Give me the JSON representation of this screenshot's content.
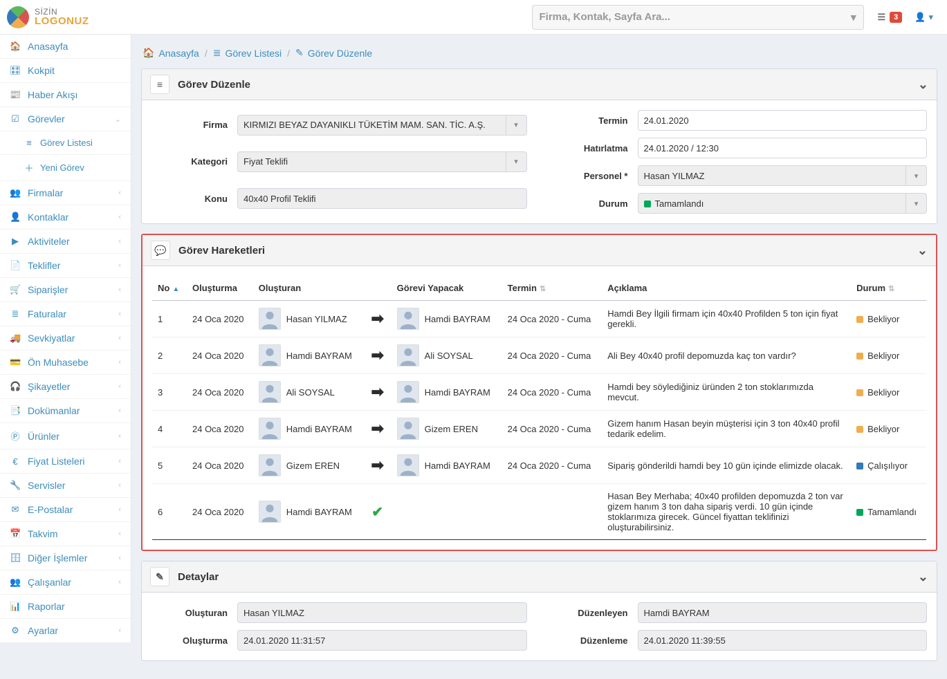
{
  "header": {
    "logo_top": "SİZİN",
    "logo_bottom": "LOGONUZ",
    "search_placeholder": "Firma, Kontak, Sayfa Ara...",
    "notif_count": "3"
  },
  "sidebar": {
    "home": "Anasayfa",
    "cockpit": "Kokpit",
    "news": "Haber Akışı",
    "tasks": "Görevler",
    "task_list": "Görev Listesi",
    "new_task": "Yeni Görev",
    "companies": "Firmalar",
    "contacts": "Kontaklar",
    "activities": "Aktiviteler",
    "offers": "Teklifler",
    "orders": "Siparişler",
    "invoices": "Faturalar",
    "shipments": "Sevkiyatlar",
    "pre_acc": "Ön Muhasebe",
    "complaints": "Şikayetler",
    "docs": "Dokümanlar",
    "products": "Ürünler",
    "pricelists": "Fiyat Listeleri",
    "services": "Servisler",
    "emails": "E-Postalar",
    "calendar": "Takvim",
    "other": "Diğer İşlemler",
    "employees": "Çalışanlar",
    "reports": "Raporlar",
    "settings": "Ayarlar"
  },
  "breadcrumb": {
    "home": "Anasayfa",
    "tasks": "Görev Listesi",
    "edit": "Görev Düzenle"
  },
  "edit_panel": {
    "title": "Görev Düzenle",
    "labels": {
      "firma": "Firma",
      "kategori": "Kategori",
      "konu": "Konu",
      "termin": "Termin",
      "hatirlatma": "Hatırlatma",
      "personel": "Personel *",
      "durum": "Durum"
    },
    "values": {
      "firma": "KIRMIZI BEYAZ DAYANIKLI TÜKETİM MAM. SAN. TİC. A.Ş.",
      "kategori": "Fiyat Teklifi",
      "konu": "40x40 Profil Teklifi",
      "termin": "24.01.2020",
      "hatirlatma": "24.01.2020 / 12:30",
      "personel": "Hasan YILMAZ",
      "durum": "Tamamlandı"
    }
  },
  "movements": {
    "title": "Görev Hareketleri",
    "headers": {
      "no": "No",
      "olusturma": "Oluşturma",
      "olusturan": "Oluşturan",
      "gorevi": "Görevi Yapacak",
      "termin": "Termin",
      "aciklama": "Açıklama",
      "durum": "Durum"
    },
    "rows": [
      {
        "no": "1",
        "olusturma": "24 Oca 2020",
        "olusturan": "Hasan YILMAZ",
        "kind": "arrow",
        "gorevi": "Hamdi BAYRAM",
        "termin": "24 Oca 2020 - Cuma",
        "aciklama": "Hamdi Bey İlgili firmam için 40x40 Profilden 5 ton için fiyat gerekli.",
        "durum": "Bekliyor",
        "dclass": "s-wait"
      },
      {
        "no": "2",
        "olusturma": "24 Oca 2020",
        "olusturan": "Hamdi BAYRAM",
        "kind": "arrow",
        "gorevi": "Ali SOYSAL",
        "termin": "24 Oca 2020 - Cuma",
        "aciklama": "Ali Bey 40x40 profil depomuzda kaç ton vardır?",
        "durum": "Bekliyor",
        "dclass": "s-wait"
      },
      {
        "no": "3",
        "olusturma": "24 Oca 2020",
        "olusturan": "Ali SOYSAL",
        "kind": "arrow",
        "gorevi": "Hamdi BAYRAM",
        "termin": "24 Oca 2020 - Cuma",
        "aciklama": "Hamdi bey söylediğiniz üründen 2 ton stoklarımızda mevcut.",
        "durum": "Bekliyor",
        "dclass": "s-wait"
      },
      {
        "no": "4",
        "olusturma": "24 Oca 2020",
        "olusturan": "Hamdi BAYRAM",
        "kind": "arrow",
        "gorevi": "Gizem EREN",
        "termin": "24 Oca 2020 - Cuma",
        "aciklama": "Gizem hanım Hasan beyin müşterisi için 3 ton 40x40 profil tedarik edelim.",
        "durum": "Bekliyor",
        "dclass": "s-wait"
      },
      {
        "no": "5",
        "olusturma": "24 Oca 2020",
        "olusturan": "Gizem EREN",
        "kind": "arrow",
        "gorevi": "Hamdi BAYRAM",
        "termin": "24 Oca 2020 - Cuma",
        "aciklama": "Sipariş gönderildi hamdi bey 10 gün içinde elimizde olacak.",
        "durum": "Çalışılıyor",
        "dclass": "s-work"
      },
      {
        "no": "6",
        "olusturma": "24 Oca 2020",
        "olusturan": "Hamdi BAYRAM",
        "kind": "check",
        "gorevi": "",
        "termin": "",
        "aciklama": "Hasan Bey Merhaba; 40x40 profilden depomuzda 2 ton var gizem hanım 3 ton daha sipariş verdi. 10 gün içinde stoklarımıza girecek. Güncel fiyattan teklifinizi oluşturabilirsiniz.",
        "durum": "Tamamlandı",
        "dclass": "s-done"
      }
    ]
  },
  "details": {
    "title": "Detaylar",
    "labels": {
      "olusturan": "Oluşturan",
      "olusturma": "Oluşturma",
      "duzenleyen": "Düzenleyen",
      "duzenleme": "Düzenleme"
    },
    "values": {
      "olusturan": "Hasan YILMAZ",
      "olusturma": "24.01.2020 11:31:57",
      "duzenleyen": "Hamdi BAYRAM",
      "duzenleme": "24.01.2020 11:39:55"
    }
  }
}
